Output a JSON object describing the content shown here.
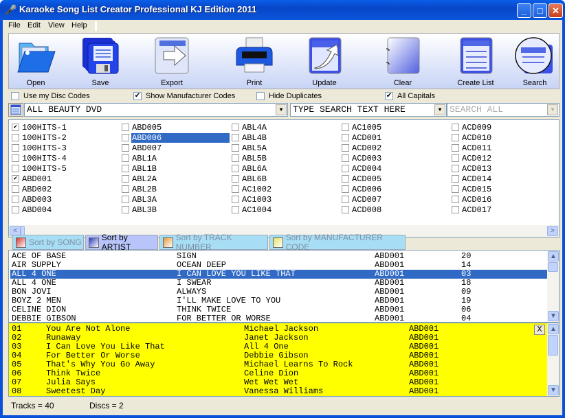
{
  "window": {
    "title": "Karaoke Song List Creator Professional KJ Edition 2011",
    "minimize": "_",
    "maximize": "□",
    "close": "✕"
  },
  "menu": [
    "File",
    "Edit",
    "View",
    "Help"
  ],
  "toolbar": [
    {
      "label": "Open",
      "icon": "folder-open-icon"
    },
    {
      "label": "Save",
      "icon": "floppy-disk-icon"
    },
    {
      "label": "Export",
      "icon": "export-arrow-icon"
    },
    {
      "label": "Print",
      "icon": "printer-icon"
    },
    {
      "label": "Update",
      "icon": "update-arrow-icon"
    },
    {
      "label": "Clear",
      "icon": "blank-notebook-icon"
    },
    {
      "label": "Create List",
      "icon": "create-list-icon"
    },
    {
      "label": "Search",
      "icon": "magnifier-search-icon"
    }
  ],
  "options": [
    {
      "label": "Use my Disc Codes",
      "checked": false
    },
    {
      "label": "Show Manufacturer Codes",
      "checked": true
    },
    {
      "label": "Hide Duplicates",
      "checked": false
    },
    {
      "label": "All Capitals",
      "checked": true
    }
  ],
  "filters": {
    "manufacturer": "ALL BEAUTY DVD",
    "search_text": "TYPE SEARCH TEXT HERE",
    "search_scope": "SEARCH ALL"
  },
  "discs": [
    [
      {
        "code": "100HITS-1",
        "checked": true
      },
      {
        "code": "100HITS-2",
        "checked": false
      },
      {
        "code": "100HITS-3",
        "checked": false
      },
      {
        "code": "100HITS-4",
        "checked": false
      },
      {
        "code": "100HITS-5",
        "checked": false
      },
      {
        "code": "ABD001",
        "checked": true
      },
      {
        "code": "ABD002",
        "checked": false
      },
      {
        "code": "ABD003",
        "checked": false
      },
      {
        "code": "ABD004",
        "checked": false
      }
    ],
    [
      {
        "code": "ABD005",
        "checked": false
      },
      {
        "code": "ABD006",
        "checked": false,
        "selected": true
      },
      {
        "code": "ABD007",
        "checked": false
      },
      {
        "code": "ABL1A",
        "checked": false
      },
      {
        "code": "ABL1B",
        "checked": false
      },
      {
        "code": "ABL2A",
        "checked": false
      },
      {
        "code": "ABL2B",
        "checked": false
      },
      {
        "code": "ABL3A",
        "checked": false
      },
      {
        "code": "ABL3B",
        "checked": false
      }
    ],
    [
      {
        "code": "ABL4A",
        "checked": false
      },
      {
        "code": "ABL4B",
        "checked": false
      },
      {
        "code": "ABL5A",
        "checked": false
      },
      {
        "code": "ABL5B",
        "checked": false
      },
      {
        "code": "ABL6A",
        "checked": false
      },
      {
        "code": "ABL6B",
        "checked": false
      },
      {
        "code": "AC1002",
        "checked": false
      },
      {
        "code": "AC1003",
        "checked": false
      },
      {
        "code": "AC1004",
        "checked": false
      }
    ],
    [
      {
        "code": "AC1005",
        "checked": false
      },
      {
        "code": "ACD001",
        "checked": false
      },
      {
        "code": "ACD002",
        "checked": false
      },
      {
        "code": "ACD003",
        "checked": false
      },
      {
        "code": "ACD004",
        "checked": false
      },
      {
        "code": "ACD005",
        "checked": false
      },
      {
        "code": "ACD006",
        "checked": false
      },
      {
        "code": "ACD007",
        "checked": false
      },
      {
        "code": "ACD008",
        "checked": false
      }
    ],
    [
      {
        "code": "ACD009",
        "checked": false
      },
      {
        "code": "ACD010",
        "checked": false
      },
      {
        "code": "ACD011",
        "checked": false
      },
      {
        "code": "ACD012",
        "checked": false
      },
      {
        "code": "ACD013",
        "checked": false
      },
      {
        "code": "ACD014",
        "checked": false
      },
      {
        "code": "ACD015",
        "checked": false
      },
      {
        "code": "ACD016",
        "checked": false
      },
      {
        "code": "ACD017",
        "checked": false
      }
    ]
  ],
  "sort_tabs": [
    {
      "label": "Sort by SONG",
      "active": false,
      "color": "#d83a3a"
    },
    {
      "label": "Sort by ARTIST",
      "active": true,
      "color": "#2a3fb8"
    },
    {
      "label": "Sort by TRACK NUMBER",
      "active": false,
      "color": "#e89a3a"
    },
    {
      "label": "Sort by MANUFACTURER CODE",
      "active": false,
      "color": "#e8e060"
    }
  ],
  "song_list": [
    {
      "artist": "ACE OF BASE",
      "song": "SIGN",
      "disc": "ABD001",
      "track": "20"
    },
    {
      "artist": "AIR SUPPLY",
      "song": "OCEAN DEEP",
      "disc": "ABD001",
      "track": "14"
    },
    {
      "artist": "ALL 4 ONE",
      "song": "I CAN LOVE YOU LIKE THAT",
      "disc": "ABD001",
      "track": "03",
      "selected": true
    },
    {
      "artist": "ALL 4 ONE",
      "song": "I SWEAR",
      "disc": "ABD001",
      "track": "18"
    },
    {
      "artist": "BON JOVI",
      "song": "ALWAYS",
      "disc": "ABD001",
      "track": "09"
    },
    {
      "artist": "BOYZ 2 MEN",
      "song": "I'LL MAKE LOVE TO YOU",
      "disc": "ABD001",
      "track": "19"
    },
    {
      "artist": "CELINE DION",
      "song": "THINK TWICE",
      "disc": "ABD001",
      "track": "06"
    },
    {
      "artist": "DEBBIE GIBSON",
      "song": "FOR BETTER OR WORSE",
      "disc": "ABD001",
      "track": "04"
    }
  ],
  "disc_tracks": [
    {
      "track": "01",
      "song": "You Are Not Alone",
      "artist": "Michael Jackson",
      "disc": "ABD001"
    },
    {
      "track": "02",
      "song": "Runaway",
      "artist": "Janet Jackson",
      "disc": "ABD001"
    },
    {
      "track": "03",
      "song": "I Can Love You Like That",
      "artist": "All 4 One",
      "disc": "ABD001"
    },
    {
      "track": "04",
      "song": "For Better Or Worse",
      "artist": "Debbie Gibson",
      "disc": "ABD001"
    },
    {
      "track": "05",
      "song": "That's Why You Go Away",
      "artist": "Michael Learns To Rock",
      "disc": "ABD001"
    },
    {
      "track": "06",
      "song": "Think Twice",
      "artist": "Celine Dion",
      "disc": "ABD001"
    },
    {
      "track": "07",
      "song": "Julia Says",
      "artist": "Wet Wet Wet",
      "disc": "ABD001"
    },
    {
      "track": "08",
      "song": "Sweetest Day",
      "artist": "Vanessa Williams",
      "disc": "ABD001"
    }
  ],
  "disc_tracks_close": "X",
  "status": {
    "tracks": "Tracks = 40",
    "discs": "Discs = 2"
  },
  "colors": {
    "selection": "#316ac5",
    "track_panel_bg": "#ffff00",
    "titlebar": "#0a50d8"
  }
}
